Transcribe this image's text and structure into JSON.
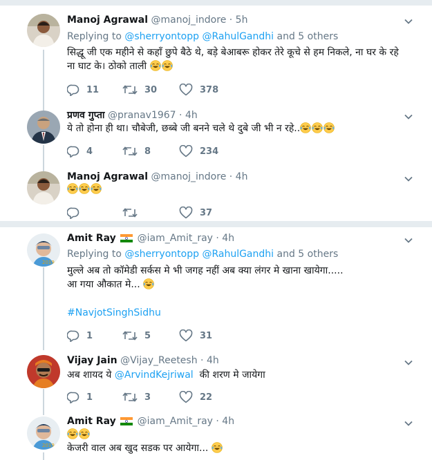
{
  "tweets": [
    {
      "name": "Manoj Agrawal",
      "handle": "@manoj_indore",
      "time": "· 5h",
      "reply_prefix": "Replying to",
      "reply_to_1": "@sherryontopp",
      "reply_to_2": "@RahulGandhi",
      "reply_suffix": "and 5 others",
      "text_line1": "सिद्धू जी एक महीने से कहाँ छुपे बैठे थे, बड़े बेआबरू होकर तेरे कूचे से हम निकले, ना घर के रहे",
      "text_line2": "ना घाट के। ठोको ताली",
      "replies": "11",
      "retweets": "30",
      "likes": "378"
    },
    {
      "name": "प्रणव गुप्ता",
      "handle": "@pranav1967",
      "time": "· 4h",
      "text_line1": "ये तो होना ही था। चौबेजी, छब्बे जी बनने चले थे दुबे जी भी न रहे..",
      "replies": "4",
      "retweets": "8",
      "likes": "234"
    },
    {
      "name": "Manoj Agrawal",
      "handle": "@manoj_indore",
      "time": "· 4h",
      "replies": "",
      "retweets": "",
      "likes": "37"
    },
    {
      "name": "Amit Ray",
      "handle": "@iam_Amit_ray",
      "time": "· 4h",
      "reply_prefix": "Replying to",
      "reply_to_1": "@sherryontopp",
      "reply_to_2": "@RahulGandhi",
      "reply_suffix": "and 5 others",
      "text_line1": "मुल्ले अब तो कॉमेडी सर्कस मे भी जगह नहीं अब क्या लंगर मे खाना खायेगा.....",
      "text_line2": "आ गया औकात मे...",
      "hashtag": "#NavjotSinghSidhu",
      "replies": "1",
      "retweets": "5",
      "likes": "31"
    },
    {
      "name": "Vijay Jain",
      "handle": "@Vijay_Reetesh",
      "time": "· 4h",
      "text_pre": "अब शायद ये",
      "mention": "@ArvindKejriwal",
      "text_post": "की शरण मे जायेगा",
      "replies": "1",
      "retweets": "3",
      "likes": "22"
    },
    {
      "name": "Amit Ray",
      "handle": "@iam_Amit_ray",
      "time": "· 4h",
      "text_line2": "केजरी वाल अब खुद सडक पर आयेगा..."
    }
  ],
  "icons": {
    "reply": "reply-icon",
    "retweet": "retweet-icon",
    "like": "heart-icon",
    "more": "chevron-down-icon",
    "emoji": "tears-of-joy-emoji",
    "flag": "india-flag-icon"
  },
  "colors": {
    "link": "#1da1f2",
    "muted": "#657786",
    "separator": "#e6ecf0",
    "thread": "#ccd6dd"
  }
}
